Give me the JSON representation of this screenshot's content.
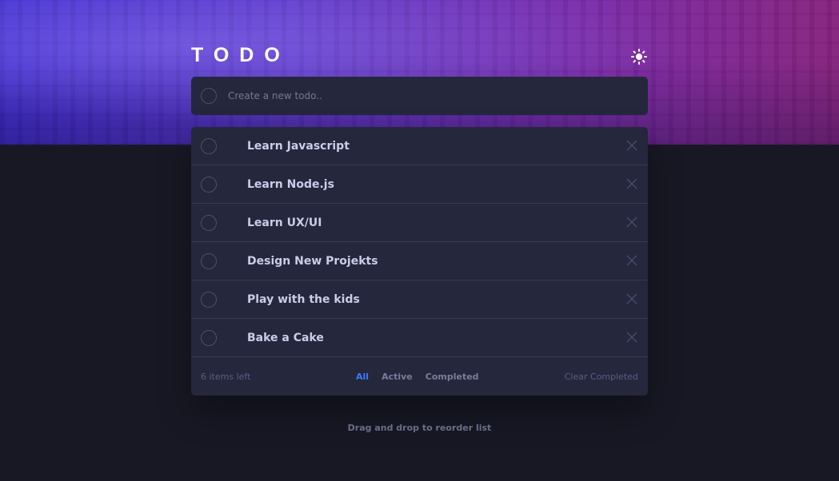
{
  "app": {
    "title": "TODO"
  },
  "header": {
    "theme_icon": "sun-icon"
  },
  "new_todo": {
    "placeholder": "Create a new todo.."
  },
  "todos": [
    {
      "label": "Learn Javascript",
      "completed": false
    },
    {
      "label": "Learn Node.js",
      "completed": false
    },
    {
      "label": "Learn UX/UI",
      "completed": false
    },
    {
      "label": "Design New Projekts",
      "completed": false
    },
    {
      "label": "Play with the kids",
      "completed": false
    },
    {
      "label": "Bake a Cake",
      "completed": false
    }
  ],
  "footer": {
    "items_left": "6 items left",
    "filters": [
      "All",
      "Active",
      "Completed"
    ],
    "active_filter": "All",
    "clear_label": "Clear Completed"
  },
  "hint": "Drag and drop to reorder list",
  "colors": {
    "background": "#181824",
    "card": "#25273c",
    "accent": "#3a7bfd",
    "text": "#cacde8"
  }
}
